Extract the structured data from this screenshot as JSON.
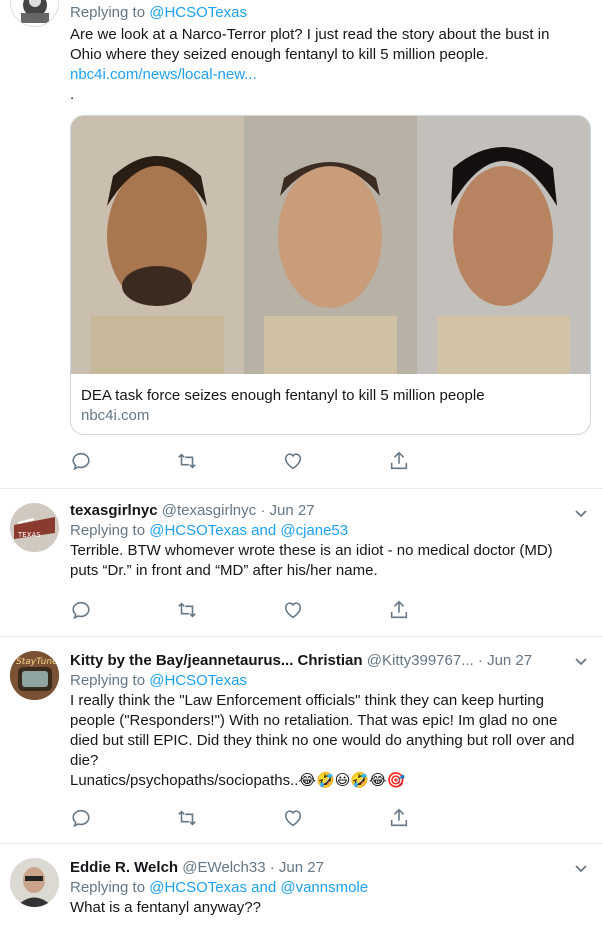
{
  "tweet1": {
    "reply_prefix": "Replying to ",
    "reply_to": "@HCSOTexas",
    "text": "Are we look at a Narco-Terror plot? I just read the story about the bust in Ohio where they seized enough fentanyl to kill 5 million people.",
    "link": "nbc4i.com/news/local-new...",
    "trailing": ".",
    "card": {
      "title": "DEA task force seizes enough fentanyl to kill 5 million people",
      "domain": "nbc4i.com"
    }
  },
  "tweet2": {
    "name": "texasgirlnyc",
    "handle": "@texasgirlnyc",
    "separator": "·",
    "time": "Jun 27",
    "reply_prefix": "Replying to ",
    "reply_to": "@HCSOTexas",
    "reply_and": " and ",
    "reply_to2": "@cjane53",
    "text_line1": "Terrible. BTW whomever wrote these is an idiot - no medical doctor (MD)",
    "text_line2": "puts “Dr.” in front and “MD” after his/her name."
  },
  "tweet3": {
    "name": "Kitty by the Bay/jeannetaurus... Christian",
    "handle": "@Kitty399767...",
    "separator": "·",
    "time": "Jun 27",
    "reply_prefix": "Replying to ",
    "reply_to": "@HCSOTexas",
    "text_line1": "I really think the \"Law Enforcement officials\" think they can keep hurting",
    "text_line2": "people (\"Responders!\") With no retaliation. That was epic! Im glad no one",
    "text_line3": "died but still EPIC. Did they think no one would do anything but roll over and",
    "text_line4": "die?",
    "text_line5": "Lunatics/psychopaths/sociopaths..",
    "emojis": "😂🤣😃🤣😂🎯"
  },
  "tweet4": {
    "name": "Eddie R. Welch",
    "handle": "@EWelch33",
    "separator": "·",
    "time": "Jun 27",
    "reply_prefix": "Replying to ",
    "reply_to": "@HCSOTexas",
    "reply_and": " and ",
    "reply_to2": "@vannsmole",
    "text": "What is a fentanyl anyway??"
  },
  "icons": [
    "reply-icon",
    "retweet-icon",
    "like-icon",
    "share-icon",
    "chevron-down-icon"
  ],
  "colors": {
    "accent": "#1da1f2",
    "secondary": "#657786",
    "border": "#e6ecf0"
  }
}
